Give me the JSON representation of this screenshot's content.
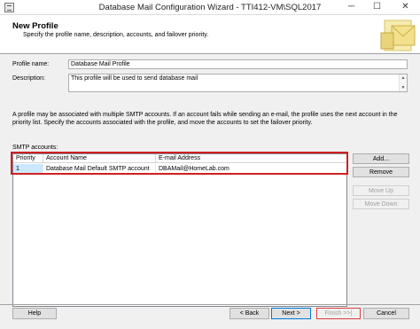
{
  "window": {
    "title": "Database Mail Configuration Wizard - TTI412-VM\\SQL2017",
    "minimize": "─",
    "maximize": "☐",
    "close": "✕"
  },
  "header": {
    "title": "New Profile",
    "subtitle": "Specify the profile name, description, accounts, and failover priority."
  },
  "form": {
    "profile_name_label": "Profile name:",
    "profile_name_value": "Database Mail Profile",
    "description_label": "Description:",
    "description_value": "This profile will be used to send database mail",
    "info_text": "A profile may be associated with multiple SMTP accounts. If an account fails while sending an e-mail, the profile uses the next account in the priority list. Specify the accounts associated with the profile, and move the accounts to set the failover priority.",
    "smtp_label": "SMTP accounts:"
  },
  "smtp_table": {
    "columns": [
      "Priority",
      "Account Name",
      "E-mail Address"
    ],
    "rows": [
      {
        "priority": "1",
        "account_name": "Database Mail Default SMTP account",
        "email": "DBAMail@HomeLab.com"
      }
    ]
  },
  "side_buttons": {
    "add": "Add...",
    "remove": "Remove",
    "move_up": "Move Up",
    "move_down": "Move Down"
  },
  "footer": {
    "help": "Help",
    "back": "< Back",
    "next": "Next >",
    "finish": "Finish >>|",
    "cancel": "Cancel"
  },
  "colors": {
    "highlight": "#d02020",
    "selection": "#cce8ff",
    "focus": "#0078d7"
  }
}
